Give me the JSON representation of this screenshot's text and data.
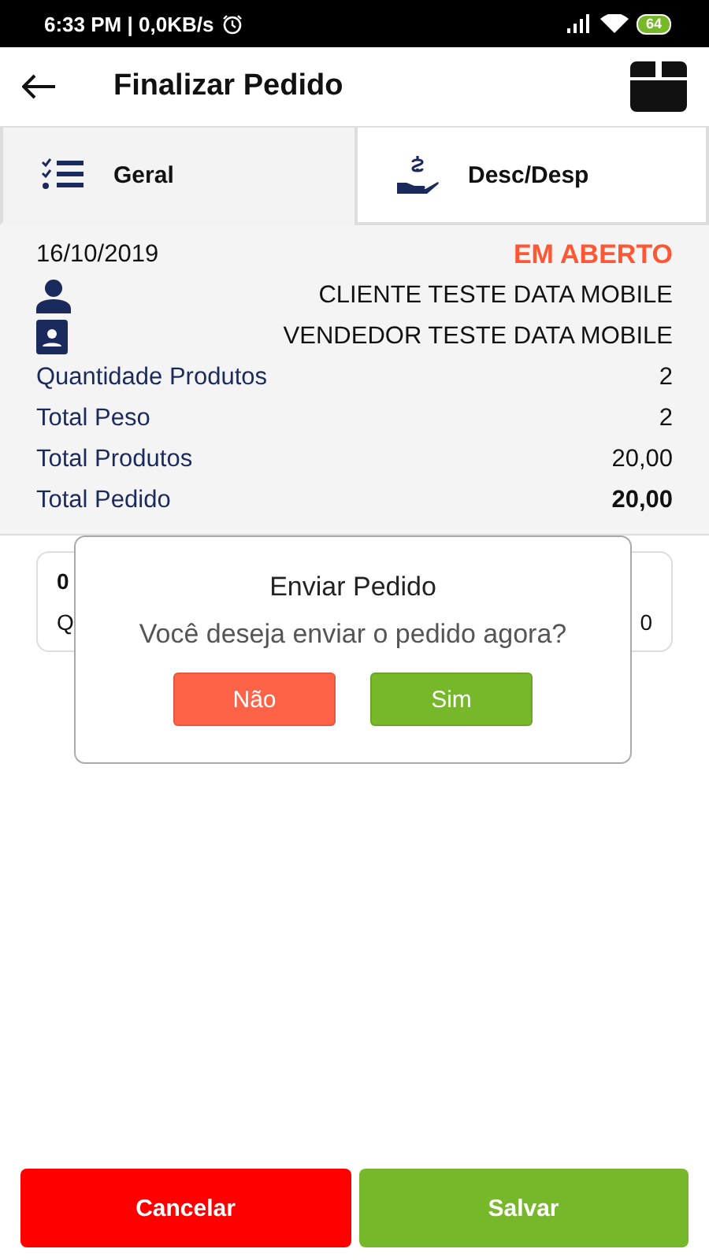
{
  "status_bar": {
    "time": "6:33 PM | 0,0KB/s",
    "battery": "64"
  },
  "header": {
    "title": "Finalizar Pedido"
  },
  "tabs": [
    {
      "label": "Geral",
      "kind": "checklist",
      "selected": true
    },
    {
      "label": "Desc/Desp",
      "kind": "money",
      "selected": false
    }
  ],
  "summary": {
    "date": "16/10/2019",
    "status": "EM ABERTO",
    "client": "CLIENTE TESTE DATA MOBILE",
    "seller": "VENDEDOR TESTE DATA MOBILE",
    "rows": [
      {
        "label": "Quantidade Produtos",
        "value": "2",
        "bold": false
      },
      {
        "label": "Total Peso",
        "value": "2",
        "bold": false
      },
      {
        "label": "Total Produtos",
        "value": "20,00",
        "bold": false
      },
      {
        "label": "Total Pedido",
        "value": "20,00",
        "bold": true
      }
    ]
  },
  "item_card": {
    "code": "0",
    "label": "Q",
    "value": "0"
  },
  "dialog": {
    "title": "Enviar Pedido",
    "message": "Você deseja enviar o pedido agora?",
    "buttons": [
      {
        "label": "Não",
        "kind": "negative"
      },
      {
        "label": "Sim",
        "kind": "positive"
      }
    ]
  },
  "footer": {
    "buttons": [
      {
        "label": "Cancelar",
        "kind": "negative"
      },
      {
        "label": "Salvar",
        "kind": "positive"
      }
    ]
  }
}
